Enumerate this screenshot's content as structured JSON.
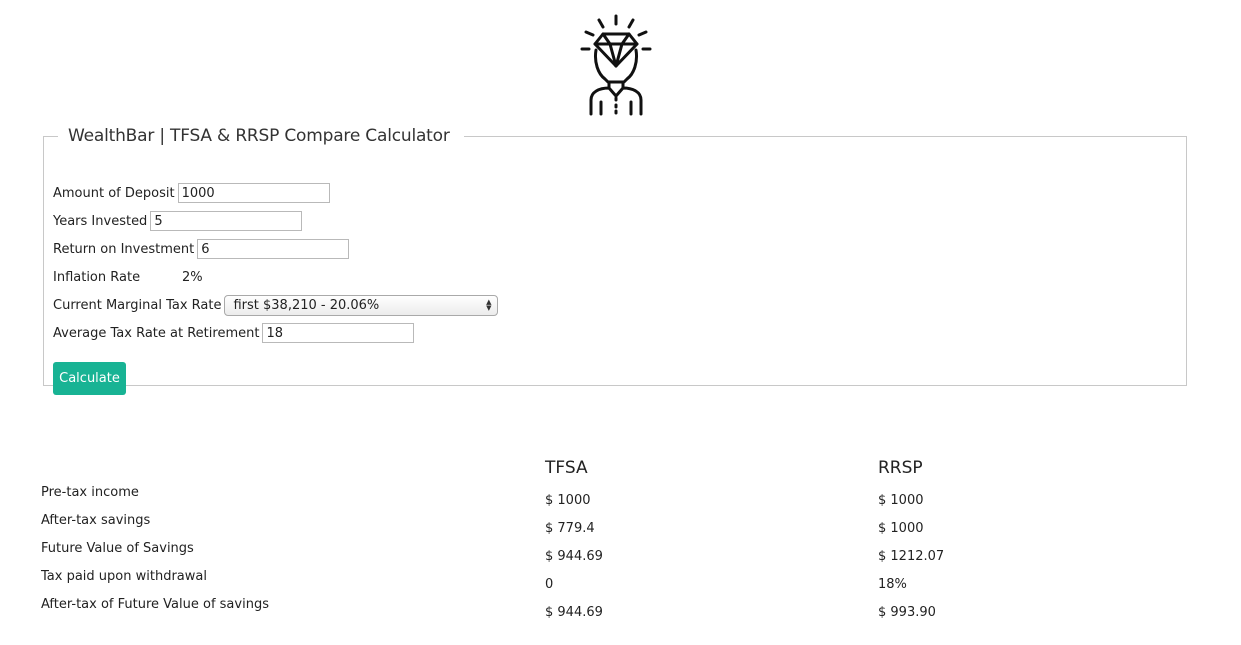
{
  "calculator": {
    "title": "WealthBar | TFSA & RRSP Compare Calculator",
    "fields": {
      "deposit": {
        "label": "Amount of Deposit",
        "value": "1000"
      },
      "years": {
        "label": "Years Invested",
        "value": "5"
      },
      "return": {
        "label": "Return on Investment",
        "value": "6"
      },
      "inflation": {
        "label": "Inflation Rate",
        "value": "2%"
      },
      "marginal_tax": {
        "label": "Current Marginal Tax Rate",
        "selected": "first $38,210 - 20.06%"
      },
      "retirement_tax": {
        "label": "Average Tax Rate at Retirement",
        "value": "18"
      }
    },
    "calculate_label": "Calculate",
    "accent_color": "#18b394"
  },
  "logo": {
    "icon": "diamond-head-person-icon"
  },
  "results": {
    "columns": [
      "TFSA",
      "RRSP"
    ],
    "rows": [
      {
        "label": "Pre-tax income",
        "tfsa": "$ 1000",
        "rrsp": "$ 1000"
      },
      {
        "label": "After-tax savings",
        "tfsa": "$ 779.4",
        "rrsp": "$ 1000"
      },
      {
        "label": "Future Value of Savings",
        "tfsa": "$ 944.69",
        "rrsp": "$ 1212.07"
      },
      {
        "label": "Tax paid upon withdrawal",
        "tfsa": "0",
        "rrsp": "18%"
      },
      {
        "label": "After-tax of Future Value of savings",
        "tfsa": "$ 944.69",
        "rrsp": "$ 993.90"
      }
    ]
  }
}
